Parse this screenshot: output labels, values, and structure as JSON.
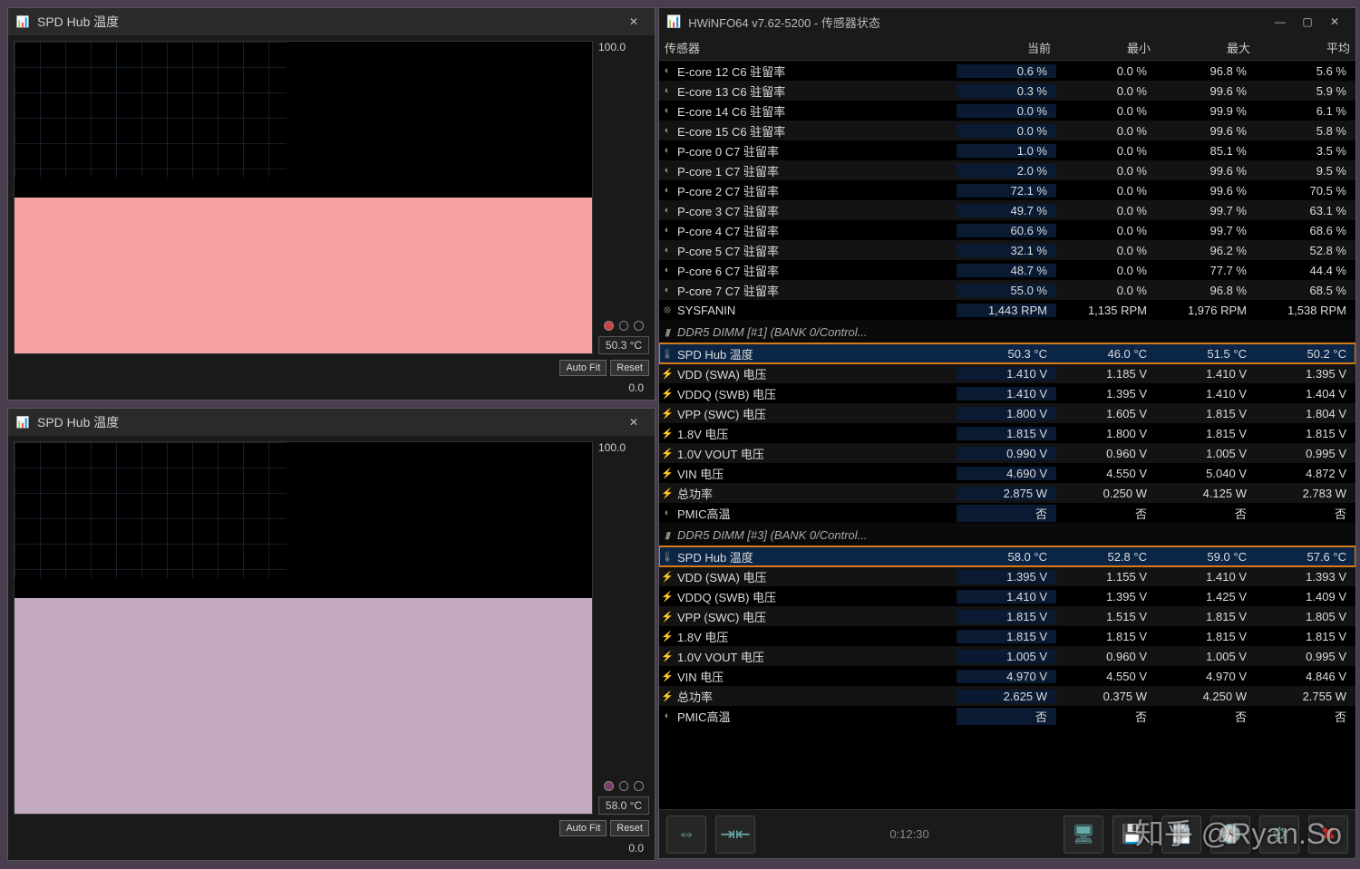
{
  "graph1": {
    "title": "SPD Hub 温度",
    "top": "100.0",
    "cur": "50.3 °C",
    "bot": "0.0",
    "autofit": "Auto Fit",
    "reset": "Reset"
  },
  "graph2": {
    "title": "SPD Hub 温度",
    "top": "100.0",
    "cur": "58.0 °C",
    "bot": "0.0",
    "autofit": "Auto Fit",
    "reset": "Reset"
  },
  "sensor": {
    "title": "HWiNFO64 v7.62-5200 - 传感器状态",
    "cols": {
      "name": "传感器",
      "cur": "当前",
      "min": "最小",
      "max": "最大",
      "avg": "平均"
    },
    "rows": [
      {
        "ic": "◐",
        "nm": "E-core 12 C6 驻留率",
        "c": "0.6 %",
        "mn": "0.0 %",
        "mx": "96.8 %",
        "av": "5.6 %"
      },
      {
        "ic": "◐",
        "nm": "E-core 13 C6 驻留率",
        "c": "0.3 %",
        "mn": "0.0 %",
        "mx": "99.6 %",
        "av": "5.9 %"
      },
      {
        "ic": "◐",
        "nm": "E-core 14 C6 驻留率",
        "c": "0.0 %",
        "mn": "0.0 %",
        "mx": "99.9 %",
        "av": "6.1 %"
      },
      {
        "ic": "◐",
        "nm": "E-core 15 C6 驻留率",
        "c": "0.0 %",
        "mn": "0.0 %",
        "mx": "99.6 %",
        "av": "5.8 %"
      },
      {
        "ic": "◐",
        "nm": "P-core 0 C7 驻留率",
        "c": "1.0 %",
        "mn": "0.0 %",
        "mx": "85.1 %",
        "av": "3.5 %"
      },
      {
        "ic": "◐",
        "nm": "P-core 1 C7 驻留率",
        "c": "2.0 %",
        "mn": "0.0 %",
        "mx": "99.6 %",
        "av": "9.5 %"
      },
      {
        "ic": "◐",
        "nm": "P-core 2 C7 驻留率",
        "c": "72.1 %",
        "mn": "0.0 %",
        "mx": "99.6 %",
        "av": "70.5 %"
      },
      {
        "ic": "◐",
        "nm": "P-core 3 C7 驻留率",
        "c": "49.7 %",
        "mn": "0.0 %",
        "mx": "99.7 %",
        "av": "63.1 %"
      },
      {
        "ic": "◐",
        "nm": "P-core 4 C7 驻留率",
        "c": "60.6 %",
        "mn": "0.0 %",
        "mx": "99.7 %",
        "av": "68.6 %"
      },
      {
        "ic": "◐",
        "nm": "P-core 5 C7 驻留率",
        "c": "32.1 %",
        "mn": "0.0 %",
        "mx": "96.2 %",
        "av": "52.8 %"
      },
      {
        "ic": "◐",
        "nm": "P-core 6 C7 驻留率",
        "c": "48.7 %",
        "mn": "0.0 %",
        "mx": "77.7 %",
        "av": "44.4 %"
      },
      {
        "ic": "◐",
        "nm": "P-core 7 C7 驻留率",
        "c": "55.0 %",
        "mn": "0.0 %",
        "mx": "96.8 %",
        "av": "68.5 %"
      },
      {
        "ic": "❊",
        "nm": "SYSFANIN",
        "c": "1,443 RPM",
        "mn": "1,135 RPM",
        "mx": "1,976 RPM",
        "av": "1,538 RPM"
      },
      {
        "section": true,
        "nm": "DDR5 DIMM [#1] (BANK 0/Control..."
      },
      {
        "ic": "🌡",
        "nm": "SPD Hub 温度",
        "c": "50.3 °C",
        "mn": "46.0 °C",
        "mx": "51.5 °C",
        "av": "50.2 °C",
        "hl": true
      },
      {
        "ic": "⚡",
        "nm": "VDD (SWA) 电压",
        "c": "1.410 V",
        "mn": "1.185 V",
        "mx": "1.410 V",
        "av": "1.395 V"
      },
      {
        "ic": "⚡",
        "nm": "VDDQ (SWB) 电压",
        "c": "1.410 V",
        "mn": "1.395 V",
        "mx": "1.410 V",
        "av": "1.404 V"
      },
      {
        "ic": "⚡",
        "nm": "VPP (SWC) 电压",
        "c": "1.800 V",
        "mn": "1.605 V",
        "mx": "1.815 V",
        "av": "1.804 V"
      },
      {
        "ic": "⚡",
        "nm": "1.8V 电压",
        "c": "1.815 V",
        "mn": "1.800 V",
        "mx": "1.815 V",
        "av": "1.815 V"
      },
      {
        "ic": "⚡",
        "nm": "1.0V VOUT 电压",
        "c": "0.990 V",
        "mn": "0.960 V",
        "mx": "1.005 V",
        "av": "0.995 V"
      },
      {
        "ic": "⚡",
        "nm": "VIN 电压",
        "c": "4.690 V",
        "mn": "4.550 V",
        "mx": "5.040 V",
        "av": "4.872 V"
      },
      {
        "ic": "⚡",
        "nm": "总功率",
        "c": "2.875 W",
        "mn": "0.250 W",
        "mx": "4.125 W",
        "av": "2.783 W"
      },
      {
        "ic": "◐",
        "nm": "PMIC高温",
        "c": "否",
        "mn": "否",
        "mx": "否",
        "av": "否"
      },
      {
        "section": true,
        "nm": "DDR5 DIMM [#3] (BANK 0/Control..."
      },
      {
        "ic": "🌡",
        "nm": "SPD Hub 温度",
        "c": "58.0 °C",
        "mn": "52.8 °C",
        "mx": "59.0 °C",
        "av": "57.6 °C",
        "hl": true
      },
      {
        "ic": "⚡",
        "nm": "VDD (SWA) 电压",
        "c": "1.395 V",
        "mn": "1.155 V",
        "mx": "1.410 V",
        "av": "1.393 V"
      },
      {
        "ic": "⚡",
        "nm": "VDDQ (SWB) 电压",
        "c": "1.410 V",
        "mn": "1.395 V",
        "mx": "1.425 V",
        "av": "1.409 V"
      },
      {
        "ic": "⚡",
        "nm": "VPP (SWC) 电压",
        "c": "1.815 V",
        "mn": "1.515 V",
        "mx": "1.815 V",
        "av": "1.805 V"
      },
      {
        "ic": "⚡",
        "nm": "1.8V 电压",
        "c": "1.815 V",
        "mn": "1.815 V",
        "mx": "1.815 V",
        "av": "1.815 V"
      },
      {
        "ic": "⚡",
        "nm": "1.0V VOUT 电压",
        "c": "1.005 V",
        "mn": "0.960 V",
        "mx": "1.005 V",
        "av": "0.995 V"
      },
      {
        "ic": "⚡",
        "nm": "VIN 电压",
        "c": "4.970 V",
        "mn": "4.550 V",
        "mx": "4.970 V",
        "av": "4.846 V"
      },
      {
        "ic": "⚡",
        "nm": "总功率",
        "c": "2.625 W",
        "mn": "0.375 W",
        "mx": "4.250 W",
        "av": "2.755 W"
      },
      {
        "ic": "◐",
        "nm": "PMIC高温",
        "c": "否",
        "mn": "否",
        "mx": "否",
        "av": "否"
      }
    ],
    "clock": "0:12:30"
  },
  "watermark": "知乎 @Ryan.So"
}
